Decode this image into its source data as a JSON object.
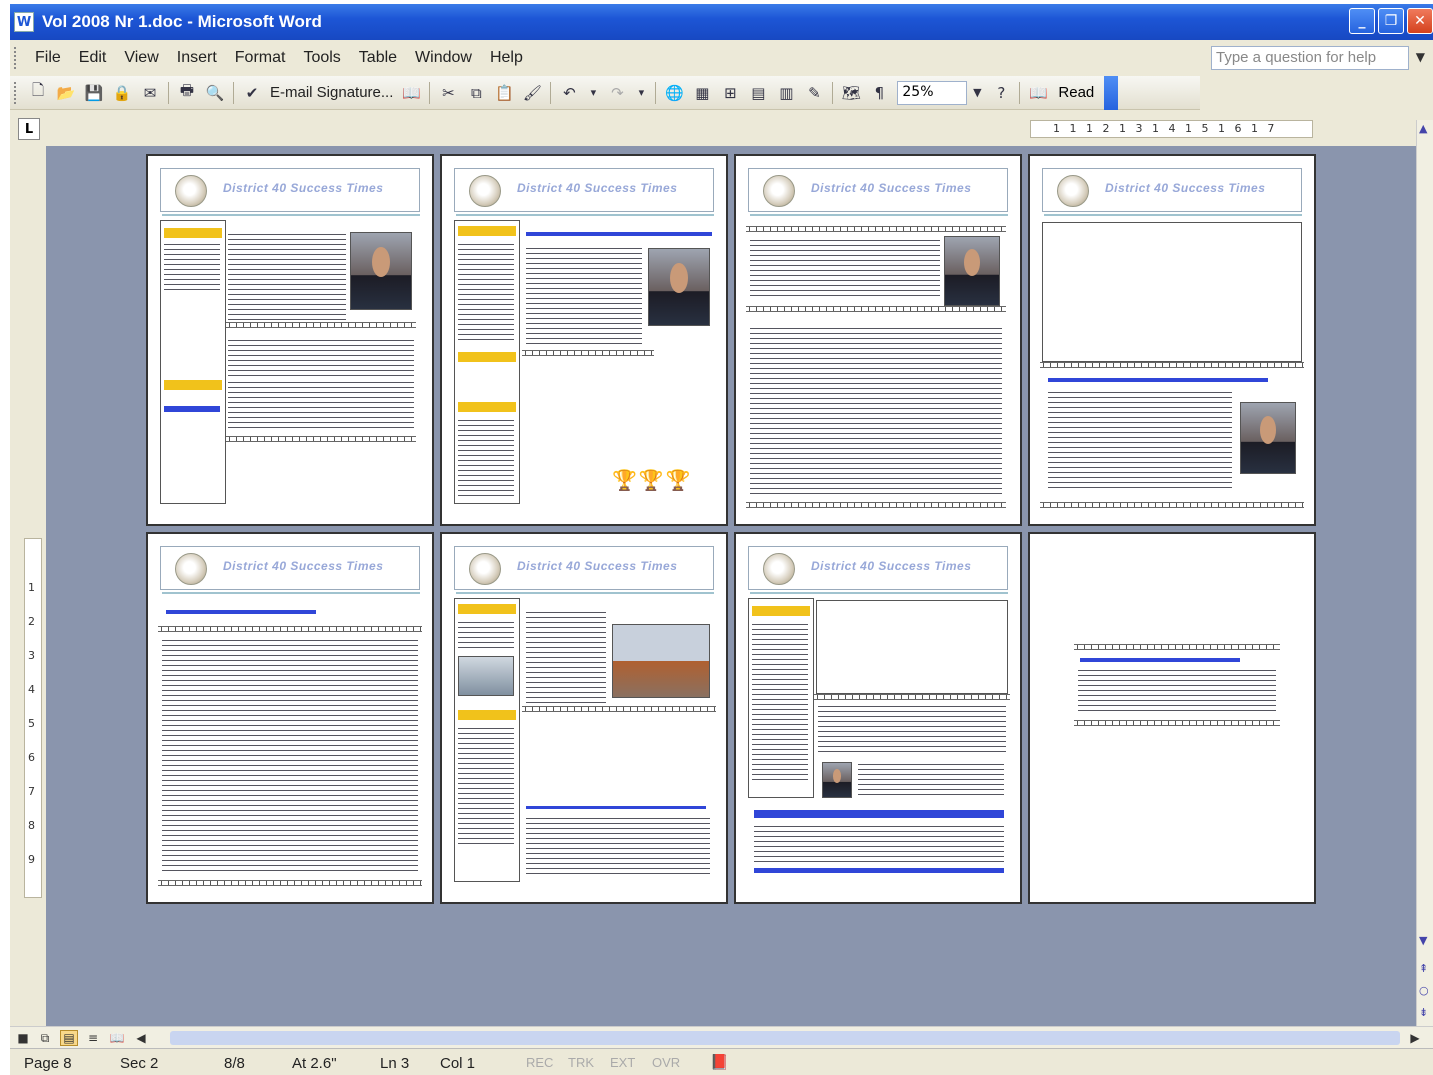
{
  "window": {
    "title": "Vol 2008 Nr 1.doc - Microsoft Word",
    "app_icon": "word-document-icon",
    "controls": [
      "minimize",
      "restore",
      "close"
    ]
  },
  "menu": {
    "items": [
      "File",
      "Edit",
      "View",
      "Insert",
      "Format",
      "Tools",
      "Table",
      "Window",
      "Help"
    ],
    "help_placeholder": "Type a question for help"
  },
  "toolbar": {
    "email_signature": "E-mail Signature...",
    "zoom": "25%",
    "read_label": "Read",
    "icons": [
      "new-icon",
      "open-icon",
      "save-icon",
      "permission-icon",
      "email-icon",
      "print-icon",
      "print-preview-icon",
      "spelling-icon",
      "research-icon",
      "cut-icon",
      "copy-icon",
      "paste-icon",
      "format-painter-icon",
      "undo-icon",
      "redo-icon",
      "hyperlink-icon",
      "tables-borders-icon",
      "insert-table-icon",
      "insert-excel-icon",
      "columns-icon",
      "drawing-icon",
      "document-map-icon",
      "show-hide-icon",
      "help-icon",
      "read-icon"
    ]
  },
  "ruler": {
    "tab_selector": "L",
    "horizontal_numbers": "1 1 1 2 1 3 1 4 1 5 1 6 1 7",
    "vertical_numbers": [
      "1",
      "2",
      "3",
      "4",
      "5",
      "6",
      "7",
      "8",
      "9"
    ]
  },
  "pages": {
    "masthead": "District 40 Success Times",
    "count": 8
  },
  "status": {
    "page": "Page 8",
    "section": "Sec 2",
    "pages": "8/8",
    "at": "At 2.6\"",
    "line": "Ln 3",
    "col": "Col 1",
    "rec": "REC",
    "trk": "TRK",
    "ext": "EXT",
    "ovr": "OVR"
  }
}
